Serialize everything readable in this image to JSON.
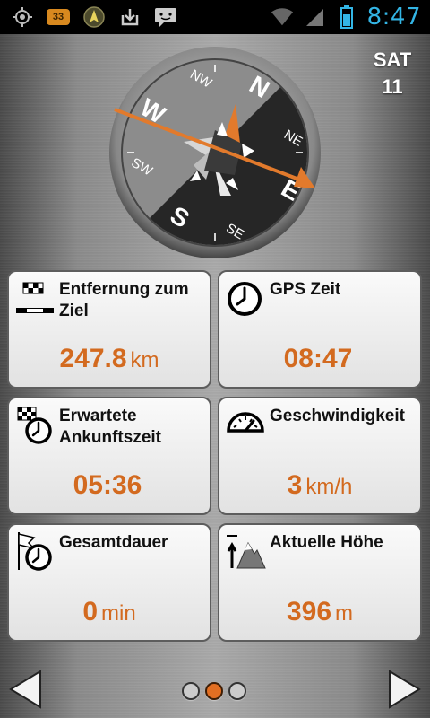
{
  "status_bar": {
    "icons": [
      "gps-target-icon",
      "battery-app-badge-icon",
      "navigation-icon",
      "download-icon",
      "messaging-icon"
    ],
    "badge_count": "33",
    "right_icons": [
      "wifi-icon",
      "signal-icon",
      "battery-icon"
    ],
    "time": "8:47"
  },
  "date": {
    "weekday": "SAT",
    "day": "11"
  },
  "compass": {
    "labels": {
      "n": "N",
      "ne": "NE",
      "e": "E",
      "se": "SE",
      "s": "S",
      "sw": "SW",
      "w": "W",
      "nw": "NW"
    },
    "accent_color": "#e27a2c"
  },
  "tiles": [
    {
      "id": "distance",
      "icon": "checkered-flag-distance-icon",
      "title": "Entfernung zum Ziel",
      "value": "247.8",
      "unit": "km"
    },
    {
      "id": "gps_time",
      "icon": "clock-icon",
      "title": "GPS Zeit",
      "value": "08:47",
      "unit": ""
    },
    {
      "id": "eta",
      "icon": "checkered-flag-clock-icon",
      "title": "Erwartete Ankunftszeit",
      "value": "05:36",
      "unit": ""
    },
    {
      "id": "speed",
      "icon": "speedometer-icon",
      "title": "Geschwindigkeit",
      "value": "3",
      "unit": "km/h"
    },
    {
      "id": "duration",
      "icon": "flag-clock-icon",
      "title": "Gesamtdauer",
      "value": "0",
      "unit": "min"
    },
    {
      "id": "altitude",
      "icon": "mountain-altitude-icon",
      "title": "Aktuelle Höhe",
      "value": "396",
      "unit": "m"
    }
  ],
  "pager": {
    "pages": 3,
    "active": 2
  },
  "colors": {
    "value": "#d36a1f",
    "status_time": "#33b5e5",
    "accent": "#e36f22"
  }
}
